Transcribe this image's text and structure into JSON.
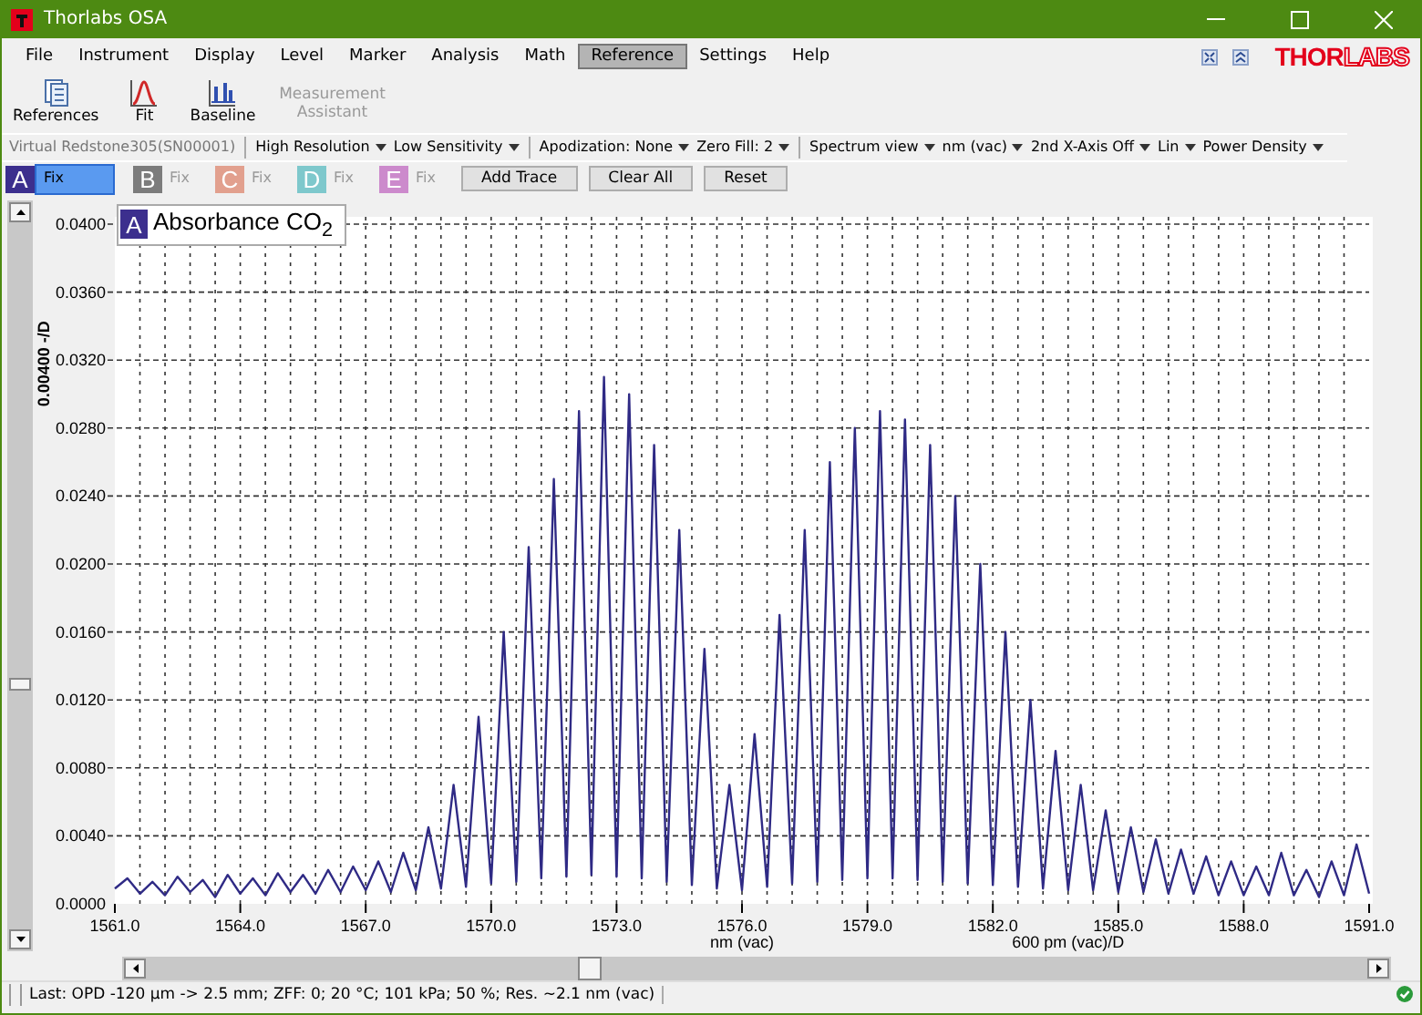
{
  "window": {
    "title": "Thorlabs OSA"
  },
  "menu": [
    {
      "label": "File",
      "selected": false
    },
    {
      "label": "Instrument",
      "selected": false
    },
    {
      "label": "Display",
      "selected": false
    },
    {
      "label": "Level",
      "selected": false
    },
    {
      "label": "Marker",
      "selected": false
    },
    {
      "label": "Analysis",
      "selected": false
    },
    {
      "label": "Math",
      "selected": false
    },
    {
      "label": "Reference",
      "selected": true
    },
    {
      "label": "Settings",
      "selected": false
    },
    {
      "label": "Help",
      "selected": false
    }
  ],
  "logo": {
    "solid": "THOR",
    "outline": "LABS"
  },
  "ribbon": [
    {
      "label": "References",
      "kind": "references",
      "disabled": false
    },
    {
      "label": "Fit",
      "kind": "fit",
      "disabled": false
    },
    {
      "label": "Baseline",
      "kind": "baseline",
      "disabled": false
    },
    {
      "label": "Measurement Assistant",
      "kind": "none",
      "disabled": true
    }
  ],
  "toolbar": {
    "device": "Virtual Redstone305(SN00001)",
    "groups": [
      [
        "High Resolution",
        "Low Sensitivity"
      ],
      [
        "Apodization: None",
        "Zero Fill: 2"
      ],
      [
        "Spectrum view",
        "nm (vac)",
        "2nd X-Axis Off",
        "Lin",
        "Power Density"
      ]
    ]
  },
  "traces": [
    {
      "letter": "A",
      "color": "#3c2f8e",
      "fix": "Fix",
      "selected": true
    },
    {
      "letter": "B",
      "color": "#7c7c7c",
      "fix": "Fix",
      "selected": false
    },
    {
      "letter": "C",
      "color": "#e2a08e",
      "fix": "Fix",
      "selected": false
    },
    {
      "letter": "D",
      "color": "#7ec8cc",
      "fix": "Fix",
      "selected": false
    },
    {
      "letter": "E",
      "color": "#cc8acc",
      "fix": "Fix",
      "selected": false
    }
  ],
  "trace_buttons": [
    "Add Trace",
    "Clear All",
    "Reset"
  ],
  "chart": {
    "legend": {
      "letter": "A",
      "label": "Absorbance CO$_{2}$"
    },
    "x_division": "600 pm (vac)/D",
    "chart_data": {
      "type": "line",
      "grid": true,
      "xlabel": "nm (vac)",
      "ylabel": "0.00400 -/D",
      "xlim": [
        1561.0,
        1591.0
      ],
      "ylim": [
        0,
        0.04
      ],
      "xticks": [
        {
          "value": 1561,
          "label": "1561.0"
        },
        {
          "value": 1564,
          "label": "1564.0"
        },
        {
          "value": 1567,
          "label": "1567.0"
        },
        {
          "value": 1570,
          "label": "1570.0"
        },
        {
          "value": 1573,
          "label": "1573.0"
        },
        {
          "value": 1576,
          "label": "1576.0"
        },
        {
          "value": 1579,
          "label": "1579.0"
        },
        {
          "value": 1582,
          "label": "1582.0"
        },
        {
          "value": 1585,
          "label": "1585.0"
        },
        {
          "value": 1588,
          "label": "1588.0"
        },
        {
          "value": 1591,
          "label": "1591.0"
        }
      ],
      "yticks": [
        {
          "value": 0,
          "label": "0.0000"
        },
        {
          "value": 0.004,
          "label": "0.0040"
        },
        {
          "value": 0.008,
          "label": "0.0080"
        },
        {
          "value": 0.012,
          "label": "0.0120"
        },
        {
          "value": 0.016,
          "label": "0.0160"
        },
        {
          "value": 0.02,
          "label": "0.0200"
        },
        {
          "value": 0.024,
          "label": "0.0240"
        },
        {
          "value": 0.028,
          "label": "0.0280"
        },
        {
          "value": 0.032,
          "label": "0.0320"
        },
        {
          "value": 0.036,
          "label": "0.0360"
        },
        {
          "value": 0.04,
          "label": "0.0400"
        }
      ],
      "x": [
        1561.0,
        1561.3,
        1561.6,
        1561.9,
        1562.2,
        1562.5,
        1562.8,
        1563.1,
        1563.4,
        1563.7,
        1564.0,
        1564.3,
        1564.6,
        1564.9,
        1565.2,
        1565.5,
        1565.8,
        1566.1,
        1566.4,
        1566.7,
        1567.0,
        1567.3,
        1567.6,
        1567.9,
        1568.2,
        1568.5,
        1568.8,
        1569.1,
        1569.4,
        1569.7,
        1570.0,
        1570.3,
        1570.6,
        1570.9,
        1571.2,
        1571.5,
        1571.8,
        1572.1,
        1572.4,
        1572.7,
        1573.0,
        1573.3,
        1573.6,
        1573.9,
        1574.2,
        1574.5,
        1574.8,
        1575.1,
        1575.4,
        1575.7,
        1576.0,
        1576.3,
        1576.6,
        1576.9,
        1577.2,
        1577.5,
        1577.8,
        1578.1,
        1578.4,
        1578.7,
        1579.0,
        1579.3,
        1579.6,
        1579.9,
        1580.2,
        1580.5,
        1580.8,
        1581.1,
        1581.4,
        1581.7,
        1582.0,
        1582.3,
        1582.6,
        1582.9,
        1583.2,
        1583.5,
        1583.8,
        1584.1,
        1584.4,
        1584.7,
        1585.0,
        1585.3,
        1585.6,
        1585.9,
        1586.2,
        1586.5,
        1586.8,
        1587.1,
        1587.4,
        1587.7,
        1588.0,
        1588.3,
        1588.6,
        1588.9,
        1589.2,
        1589.5,
        1589.8,
        1590.1,
        1590.4,
        1590.7,
        1591.0
      ],
      "series": [
        {
          "color": "#2f2a85",
          "values": [
            0.0009,
            0.0015,
            0.0006,
            0.0013,
            0.0005,
            0.0016,
            0.0007,
            0.0014,
            0.0004,
            0.0017,
            0.0006,
            0.0015,
            0.0005,
            0.0018,
            0.0007,
            0.0017,
            0.0006,
            0.002,
            0.0007,
            0.0022,
            0.0008,
            0.0025,
            0.0007,
            0.003,
            0.0008,
            0.0045,
            0.0009,
            0.007,
            0.001,
            0.011,
            0.0012,
            0.016,
            0.0013,
            0.021,
            0.0015,
            0.025,
            0.0016,
            0.029,
            0.0017,
            0.031,
            0.0016,
            0.03,
            0.0015,
            0.027,
            0.0013,
            0.022,
            0.0011,
            0.015,
            0.0009,
            0.007,
            0.0008,
            0.01,
            0.001,
            0.017,
            0.0012,
            0.022,
            0.0013,
            0.026,
            0.0014,
            0.028,
            0.0015,
            0.029,
            0.0015,
            0.0285,
            0.0014,
            0.027,
            0.0013,
            0.024,
            0.0012,
            0.02,
            0.0011,
            0.016,
            0.001,
            0.012,
            0.0009,
            0.009,
            0.0008,
            0.007,
            0.0008,
            0.0055,
            0.0007,
            0.0045,
            0.0007,
            0.0038,
            0.0006,
            0.0032,
            0.0006,
            0.0028,
            0.0005,
            0.0025,
            0.0005,
            0.0022,
            0.0005,
            0.003,
            0.0005,
            0.002,
            0.0004,
            0.0025,
            0.0005,
            0.0035,
            0.0006
          ]
        }
      ]
    }
  },
  "status": "Last: OPD -120 µm -> 2.5 mm; ZFF: 0; 20 °C; 101 kPa; 50 %; Res. ~2.1 nm (vac)"
}
